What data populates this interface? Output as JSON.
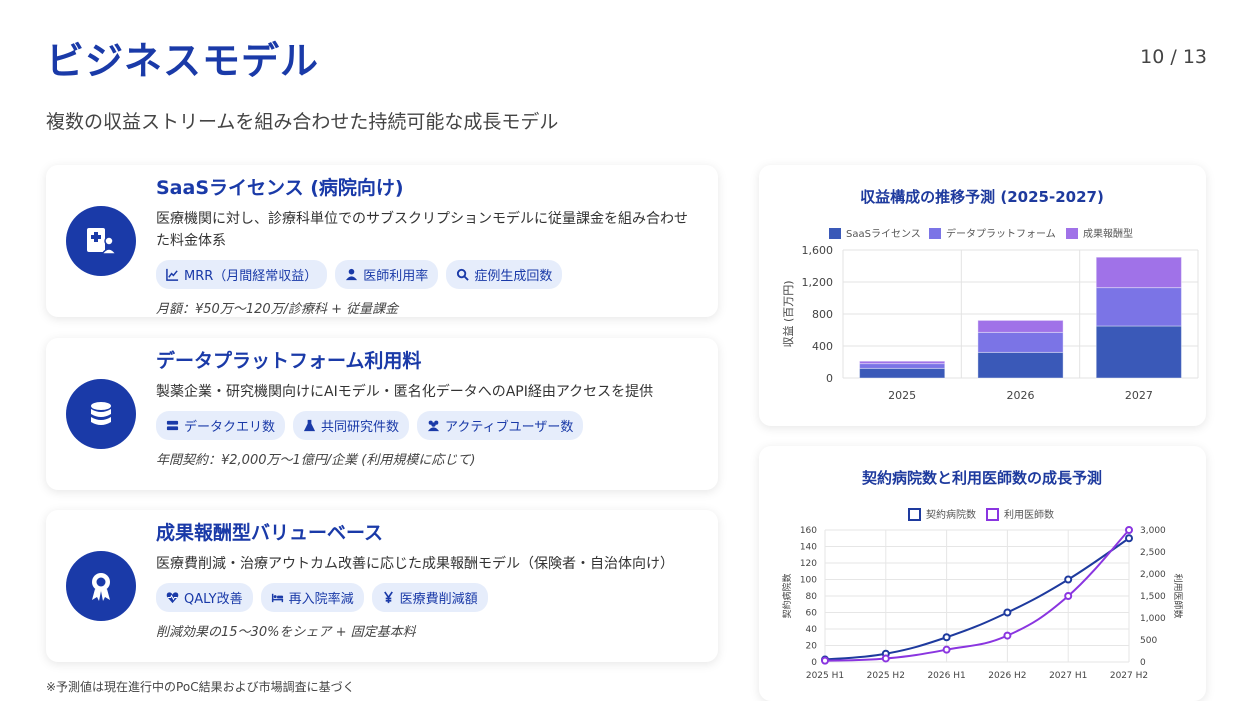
{
  "header": {
    "title": "ビジネスモデル",
    "page": "10 / 13",
    "subtitle": "複数の収益ストリームを組み合わせた持続可能な成長モデル"
  },
  "cards": [
    {
      "title": "SaaSライセンス (病院向け)",
      "desc": "医療機関に対し、診療科単位でのサブスクリプションモデルに従量課金を組み合わせた料金体系",
      "tags": [
        "MRR（月間経常収益）",
        "医師利用率",
        "症例生成回数"
      ],
      "note": "月額：¥50万〜120万/診療科 + 従量課金"
    },
    {
      "title": "データプラットフォーム利用料",
      "desc": "製薬企業・研究機関向けにAIモデル・匿名化データへのAPI経由アクセスを提供",
      "tags": [
        "データクエリ数",
        "共同研究件数",
        "アクティブユーザー数"
      ],
      "note": "年間契約：¥2,000万〜1億円/企業 (利用規模に応じて)"
    },
    {
      "title": "成果報酬型バリューベース",
      "desc": "医療費削減・治療アウトカム改善に応じた成果報酬モデル（保険者・自治体向け）",
      "tags": [
        "QALY改善",
        "再入院率減",
        "医療費削減額"
      ],
      "note": "削減効果の15〜30%をシェア + 固定基本料"
    }
  ],
  "footnote": "※予測値は現在進行中のPoC結果および市場調査に基づく",
  "colors": {
    "accent": "#1a3aa8",
    "saas": "#3a59b8",
    "data": "#7b74e6",
    "perf": "#a072e8",
    "hospitals": "#1e3a9e",
    "doctors": "#8a35e0"
  },
  "chart_data": [
    {
      "type": "bar",
      "stacked": true,
      "title": "収益構成の推移予測 (2025-2027)",
      "categories": [
        "2025",
        "2026",
        "2027"
      ],
      "series": [
        {
          "name": "SaaSライセンス",
          "values": [
            120,
            320,
            650
          ]
        },
        {
          "name": "データプラットフォーム",
          "values": [
            60,
            250,
            480
          ]
        },
        {
          "name": "成果報酬型",
          "values": [
            30,
            150,
            380
          ]
        }
      ],
      "ylabel": "収益 (百万円)",
      "ylim": [
        0,
        1600
      ],
      "yticks": [
        "0",
        "400",
        "800",
        "1,200",
        "1,600"
      ],
      "legend": "top",
      "grid": true
    },
    {
      "type": "line",
      "title": "契約病院数と利用医師数の成長予測",
      "categories": [
        "2025 H1",
        "2025 H2",
        "2026 H1",
        "2026 H2",
        "2027 H1",
        "2027 H2"
      ],
      "series": [
        {
          "name": "契約病院数",
          "axis": "left",
          "values": [
            3,
            10,
            30,
            60,
            100,
            150
          ]
        },
        {
          "name": "利用医師数",
          "axis": "right",
          "values": [
            30,
            80,
            280,
            600,
            1500,
            3000
          ]
        }
      ],
      "ylabel_left": "契約病院数",
      "ylabel_right": "利用医師数",
      "ylim_left": [
        0,
        160
      ],
      "ylim_right": [
        0,
        3000
      ],
      "yticks_left": [
        "0",
        "20",
        "40",
        "60",
        "80",
        "100",
        "120",
        "140",
        "160"
      ],
      "yticks_right": [
        "0",
        "500",
        "1,000",
        "1,500",
        "2,000",
        "2,500",
        "3,000"
      ],
      "legend": "top",
      "grid": true
    }
  ]
}
